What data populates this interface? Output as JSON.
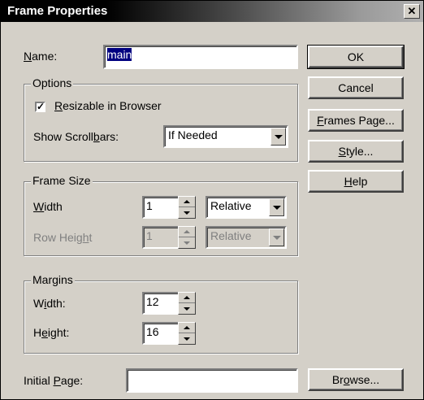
{
  "window": {
    "title": "Frame Properties",
    "close_glyph": "✕"
  },
  "name_field": {
    "label_pre": "",
    "label_u": "N",
    "label_post": "ame:",
    "value": "main"
  },
  "options": {
    "legend": "Options",
    "resizable": {
      "checked": true,
      "check_glyph": "✓",
      "label_pre": "",
      "label_u": "R",
      "label_post": "esizable in Browser"
    },
    "scrollbars": {
      "label_pre": "Show Scroll",
      "label_u": "b",
      "label_post": "ars:",
      "value": "If Needed"
    }
  },
  "frame_size": {
    "legend": "Frame Size",
    "width": {
      "label_pre": "",
      "label_u": "W",
      "label_post": "idth",
      "value": "1",
      "unit": "Relative"
    },
    "row_height": {
      "label_pre": "Row Heig",
      "label_u": "h",
      "label_post": "t",
      "value": "1",
      "unit": "Relative"
    }
  },
  "margins": {
    "legend": "Margins",
    "width": {
      "label_pre": "W",
      "label_u": "i",
      "label_post": "dth:",
      "value": "12"
    },
    "height": {
      "label_pre": "H",
      "label_u": "e",
      "label_post": "ight:",
      "value": "16"
    }
  },
  "initial_page": {
    "label_pre": "Initial ",
    "label_u": "P",
    "label_post": "age:",
    "value": ""
  },
  "buttons": {
    "ok": {
      "pre": "OK",
      "u": "",
      "post": ""
    },
    "cancel": {
      "pre": "Cancel",
      "u": "",
      "post": ""
    },
    "frames_page": {
      "pre": "",
      "u": "F",
      "post": "rames Page..."
    },
    "style": {
      "pre": "",
      "u": "S",
      "post": "tyle..."
    },
    "help": {
      "pre": "",
      "u": "H",
      "post": "elp"
    },
    "browse": {
      "pre": "Br",
      "u": "o",
      "post": "wse..."
    }
  }
}
